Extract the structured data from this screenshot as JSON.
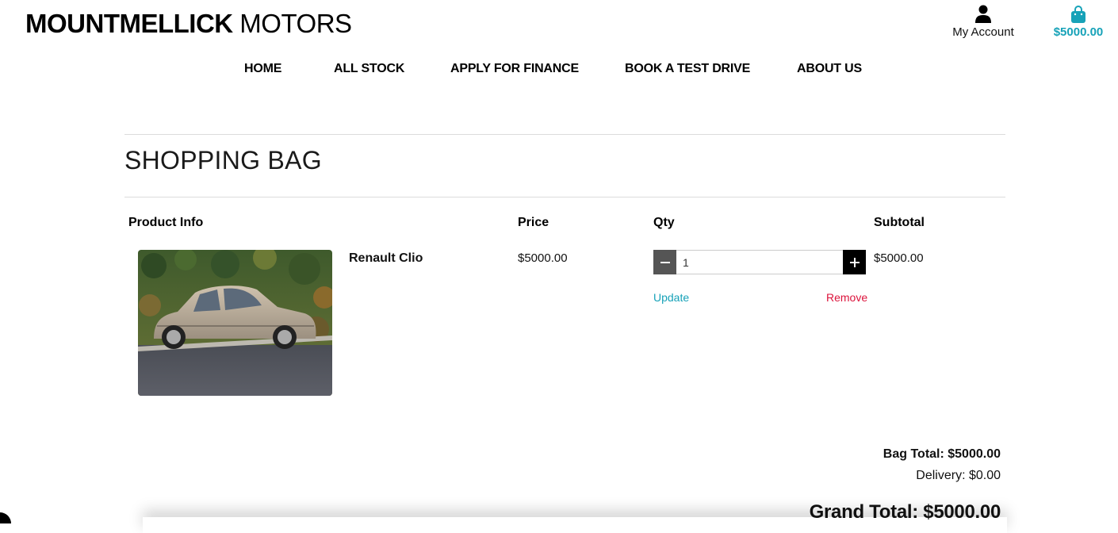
{
  "brand": {
    "bold": "MOUNTMELLICK",
    "light": " MOTORS"
  },
  "header": {
    "account_label": "My Account",
    "bag_total": "$5000.00",
    "accent_color": "#17a2b8"
  },
  "nav": {
    "items": [
      {
        "label": "HOME"
      },
      {
        "label": "ALL STOCK"
      },
      {
        "label": "APPLY FOR FINANCE"
      },
      {
        "label": "BOOK A TEST DRIVE"
      },
      {
        "label": "ABOUT US"
      }
    ]
  },
  "page": {
    "title": "SHOPPING BAG"
  },
  "table": {
    "headers": {
      "product": "Product Info",
      "price": "Price",
      "qty": "Qty",
      "subtotal": "Subtotal"
    },
    "rows": [
      {
        "name": "Renault Clio",
        "price": "$5000.00",
        "qty": "1",
        "subtotal": "$5000.00",
        "update_label": "Update",
        "remove_label": "Remove"
      }
    ]
  },
  "totals": {
    "bag_total": "Bag Total: $5000.00",
    "delivery": "Delivery: $0.00",
    "grand_total": "Grand Total: $5000.00"
  },
  "colors": {
    "link": "#17a2b8",
    "remove": "#dc143c"
  }
}
